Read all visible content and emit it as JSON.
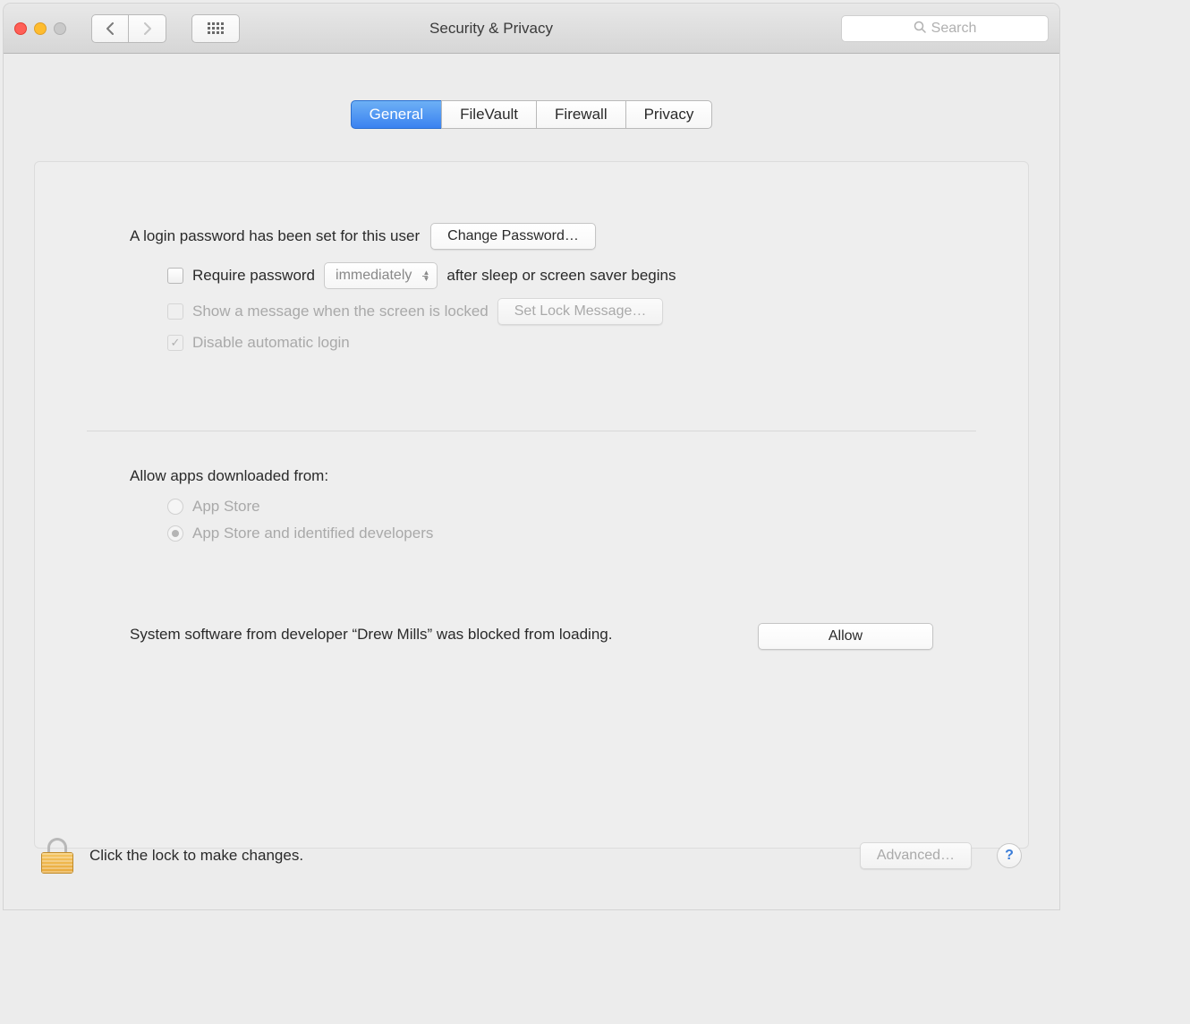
{
  "window": {
    "title": "Security & Privacy",
    "search_placeholder": "Search"
  },
  "tabs": {
    "general": "General",
    "filevault": "FileVault",
    "firewall": "Firewall",
    "privacy": "Privacy"
  },
  "login": {
    "label": "A login password has been set for this user",
    "change_button": "Change Password…",
    "require_password_label": "Require password",
    "require_password_dropdown": "immediately",
    "require_password_suffix": "after sleep or screen saver begins",
    "show_message_label": "Show a message when the screen is locked",
    "set_lock_message_button": "Set Lock Message…",
    "disable_auto_login_label": "Disable automatic login"
  },
  "apps": {
    "section_label": "Allow apps downloaded from:",
    "option_app_store": "App Store",
    "option_identified": "App Store and identified developers"
  },
  "blocked": {
    "text": "System software from developer “Drew Mills” was blocked from loading.",
    "allow_button": "Allow"
  },
  "footer": {
    "lock_text": "Click the lock to make changes.",
    "advanced_button": "Advanced…",
    "help": "?"
  }
}
